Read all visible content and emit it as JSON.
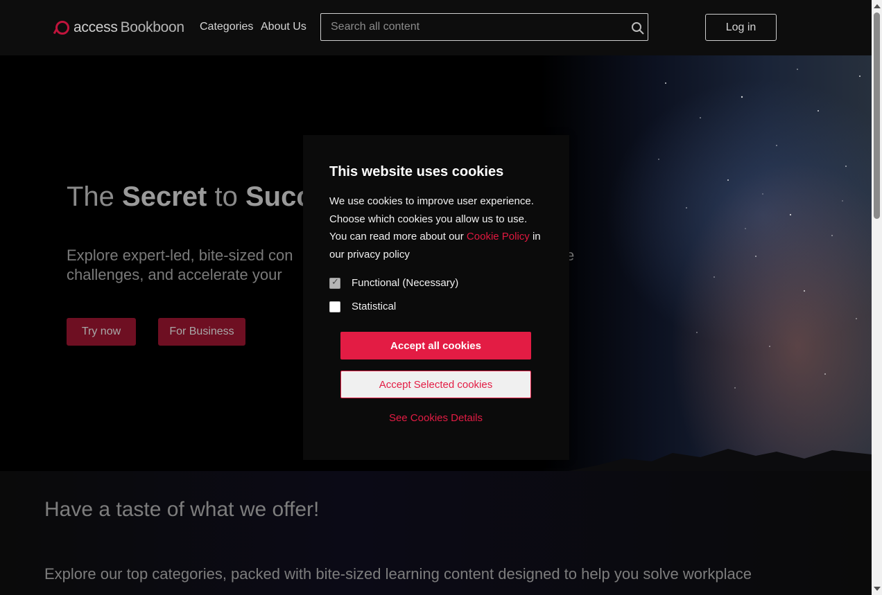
{
  "header": {
    "logo_text_1": "access",
    "logo_text_2": "Bookboon",
    "nav": [
      "Categories",
      "About Us"
    ],
    "search_placeholder": "Search all content",
    "login_label": "Log in"
  },
  "hero": {
    "title_parts": [
      "The ",
      "Secret",
      " to ",
      "Succe"
    ],
    "subtitle_left_1": "Explore expert-led, bite-sized con",
    "subtitle_right_1": "e",
    "subtitle_left_2": "challenges, and accelerate your",
    "try_now": "Try now",
    "for_business": "For Business"
  },
  "section": {
    "taste_title": "Have a taste of what we offer!",
    "explore_text": "Explore our top categories, packed with bite-sized learning content designed to help you solve workplace"
  },
  "cookie_modal": {
    "title": "This website uses cookies",
    "body_1": "We use cookies to improve user experience. Choose which cookies you allow us to use. You can read more about our ",
    "body_link": "Cookie Policy",
    "body_2": " in our privacy policy",
    "options": [
      {
        "label": "Functional (Necessary)",
        "checked": true
      },
      {
        "label": "Statistical",
        "checked": false
      }
    ],
    "accept_all": "Accept all cookies",
    "accept_selected": "Accept Selected cookies",
    "see_details": "See Cookies Details"
  },
  "colors": {
    "accent": "#e31c44",
    "hero_button": "#6e0f22",
    "logo_red": "#c0143c"
  }
}
